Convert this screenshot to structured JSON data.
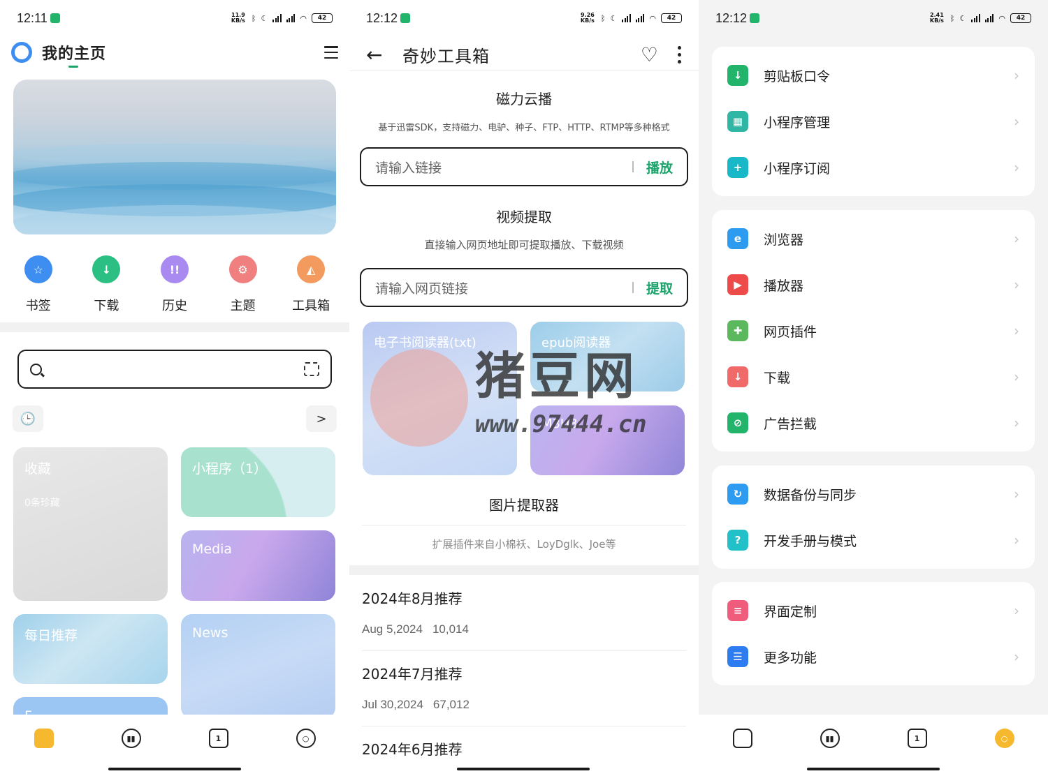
{
  "status_bars": [
    {
      "time": "12:11",
      "speed": "11.9 KB/s",
      "battery": "42"
    },
    {
      "time": "12:12",
      "speed": "9.26 KB/s",
      "battery": "42"
    },
    {
      "time": "12:12",
      "speed": "2.41 KB/s",
      "battery": "42"
    }
  ],
  "home": {
    "title": "我的主页",
    "quick_actions": [
      {
        "label": "书签",
        "icon": "star-icon",
        "color": "#3d8ef0",
        "glyph": "☆"
      },
      {
        "label": "下载",
        "icon": "download-icon",
        "color": "#2cbf83",
        "glyph": "↓"
      },
      {
        "label": "历史",
        "icon": "footprint-icon",
        "color": "#a88af0",
        "glyph": "!!"
      },
      {
        "label": "主题",
        "icon": "gear-icon",
        "color": "#f07f7f",
        "glyph": "⚙"
      },
      {
        "label": "工具箱",
        "icon": "toolbox-icon",
        "color": "#f39a5f",
        "glyph": "◭"
      }
    ],
    "search": {
      "placeholder": ""
    },
    "history_glyph": "🕒",
    "more_glyph": ">",
    "cards": [
      {
        "title": "收藏",
        "sub": "0条珍藏"
      },
      {
        "title": "小程序（1）"
      },
      {
        "title": "Media"
      },
      {
        "title": "每日推荐"
      },
      {
        "title": "News"
      },
      {
        "title": "F..."
      }
    ],
    "nav": [
      {
        "icon": "home-icon"
      },
      {
        "icon": "pause-face-icon"
      },
      {
        "icon": "tab-count-icon",
        "text": "1"
      },
      {
        "icon": "settings-hex-icon"
      }
    ]
  },
  "toolbox": {
    "title": "奇妙工具箱",
    "back_glyph": "←",
    "heart_glyph": "♡",
    "magnet": {
      "title": "磁力云播",
      "desc": "基于迅雷SDK，支持磁力、电驴、种子、FTP、HTTP、RTMP等多种格式",
      "placeholder": "请输入链接",
      "action": "播放"
    },
    "video": {
      "title": "视频提取",
      "desc": "直接输入网页地址即可提取播放、下载视频",
      "placeholder": "请输入网页链接",
      "action": "提取"
    },
    "tiles": [
      {
        "label": "电子书阅读器(txt)"
      },
      {
        "label": "epub阅读器"
      },
      {
        "label": "M3U8..."
      }
    ],
    "image_extractor": {
      "title": "图片提取器",
      "desc": "扩展插件来自小棉袄、LoyDglk、Joe等"
    },
    "recommendations": [
      {
        "title": "2024年8月推荐",
        "date": "Aug 5,2024",
        "count": "10,014"
      },
      {
        "title": "2024年7月推荐",
        "date": "Jul 30,2024",
        "count": "67,012"
      },
      {
        "title": "2024年6月推荐"
      }
    ],
    "watermark": {
      "text": "猪豆网",
      "url": "www.97444.cn"
    }
  },
  "settings": {
    "groups": [
      [
        {
          "label": "剪贴板口令",
          "icon": "clipboard-download-icon",
          "color": "#22b46b",
          "glyph": "↓"
        },
        {
          "label": "小程序管理",
          "icon": "apps-grid-icon",
          "color": "#2fb6a4",
          "glyph": "▦"
        },
        {
          "label": "小程序订阅",
          "icon": "add-subscription-icon",
          "color": "#19b8c9",
          "glyph": "+"
        }
      ],
      [
        {
          "label": "浏览器",
          "icon": "browser-icon",
          "color": "#2d9bf0",
          "glyph": "e"
        },
        {
          "label": "播放器",
          "icon": "player-icon",
          "color": "#ef4a4a",
          "glyph": "▶"
        },
        {
          "label": "网页插件",
          "icon": "puzzle-icon",
          "color": "#5cb85c",
          "glyph": "✚"
        },
        {
          "label": "下载",
          "icon": "download-tray-icon",
          "color": "#f06a6a",
          "glyph": "↓"
        },
        {
          "label": "广告拦截",
          "icon": "shield-block-icon",
          "color": "#22b46b",
          "glyph": "⊘"
        }
      ],
      [
        {
          "label": "数据备份与同步",
          "icon": "cloud-sync-icon",
          "color": "#2d9bf0",
          "glyph": "↻"
        },
        {
          "label": "开发手册与模式",
          "icon": "help-chat-icon",
          "color": "#22c1c9",
          "glyph": "?"
        }
      ],
      [
        {
          "label": "界面定制",
          "icon": "ui-custom-icon",
          "color": "#ef5c7c",
          "glyph": "≡"
        },
        {
          "label": "更多功能",
          "icon": "more-list-icon",
          "color": "#2d7cf0",
          "glyph": "☰"
        }
      ]
    ],
    "chevron": "›",
    "nav": [
      {
        "icon": "home-icon"
      },
      {
        "icon": "pause-face-icon"
      },
      {
        "icon": "tab-count-icon",
        "text": "1"
      },
      {
        "icon": "settings-hex-icon",
        "color": "#f5b82e"
      }
    ]
  }
}
